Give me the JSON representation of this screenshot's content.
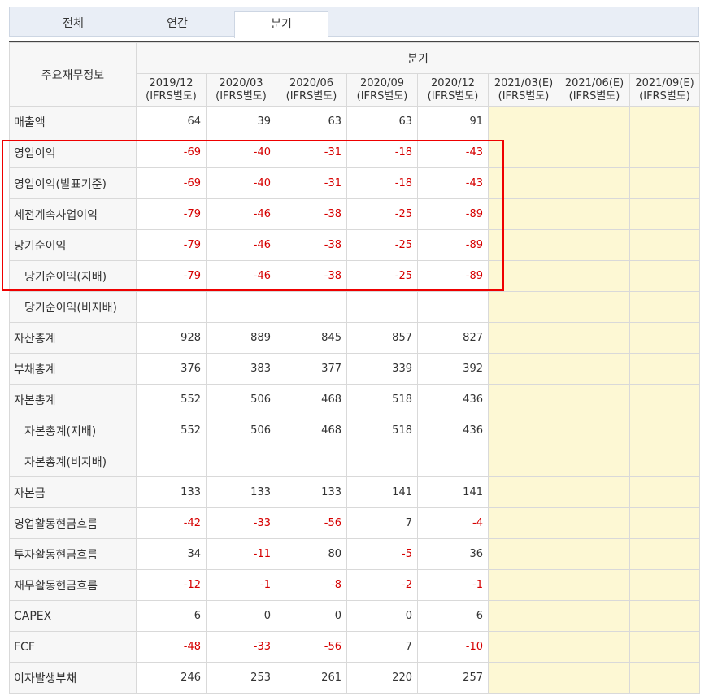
{
  "tabs": [
    {
      "label": "전체",
      "active": false
    },
    {
      "label": "연간",
      "active": false
    },
    {
      "label": "분기",
      "active": true
    }
  ],
  "table": {
    "corner_label": "주요재무정보",
    "group_label": "분기",
    "columns": [
      {
        "period": "2019/12",
        "basis": "(IFRS별도)"
      },
      {
        "period": "2020/03",
        "basis": "(IFRS별도)"
      },
      {
        "period": "2020/06",
        "basis": "(IFRS별도)"
      },
      {
        "period": "2020/09",
        "basis": "(IFRS별도)"
      },
      {
        "period": "2020/12",
        "basis": "(IFRS별도)"
      },
      {
        "period": "2021/03(E)",
        "basis": "(IFRS별도)"
      },
      {
        "period": "2021/06(E)",
        "basis": "(IFRS별도)"
      },
      {
        "period": "2021/09(E)",
        "basis": "(IFRS별도)"
      }
    ],
    "rows": [
      {
        "label": "매출액",
        "values": [
          "64",
          "39",
          "63",
          "63",
          "91",
          "",
          "",
          ""
        ]
      },
      {
        "label": "영업이익",
        "values": [
          "-69",
          "-40",
          "-31",
          "-18",
          "-43",
          "",
          "",
          ""
        ]
      },
      {
        "label": "영업이익(발표기준)",
        "values": [
          "-69",
          "-40",
          "-31",
          "-18",
          "-43",
          "",
          "",
          ""
        ]
      },
      {
        "label": "세전계속사업이익",
        "values": [
          "-79",
          "-46",
          "-38",
          "-25",
          "-89",
          "",
          "",
          ""
        ]
      },
      {
        "label": "당기순이익",
        "values": [
          "-79",
          "-46",
          "-38",
          "-25",
          "-89",
          "",
          "",
          ""
        ]
      },
      {
        "label": "당기순이익(지배)",
        "values": [
          "-79",
          "-46",
          "-38",
          "-25",
          "-89",
          "",
          "",
          ""
        ]
      },
      {
        "label": "당기순이익(비지배)",
        "values": [
          "",
          "",
          "",
          "",
          "",
          "",
          "",
          ""
        ]
      },
      {
        "label": "자산총계",
        "values": [
          "928",
          "889",
          "845",
          "857",
          "827",
          "",
          "",
          ""
        ]
      },
      {
        "label": "부채총계",
        "values": [
          "376",
          "383",
          "377",
          "339",
          "392",
          "",
          "",
          ""
        ]
      },
      {
        "label": "자본총계",
        "values": [
          "552",
          "506",
          "468",
          "518",
          "436",
          "",
          "",
          ""
        ]
      },
      {
        "label": "자본총계(지배)",
        "values": [
          "552",
          "506",
          "468",
          "518",
          "436",
          "",
          "",
          ""
        ]
      },
      {
        "label": "자본총계(비지배)",
        "values": [
          "",
          "",
          "",
          "",
          "",
          "",
          "",
          ""
        ]
      },
      {
        "label": "자본금",
        "values": [
          "133",
          "133",
          "133",
          "141",
          "141",
          "",
          "",
          ""
        ]
      },
      {
        "label": "영업활동현금흐름",
        "values": [
          "-42",
          "-33",
          "-56",
          "7",
          "-4",
          "",
          "",
          ""
        ]
      },
      {
        "label": "투자활동현금흐름",
        "values": [
          "34",
          "-11",
          "80",
          "-5",
          "36",
          "",
          "",
          ""
        ]
      },
      {
        "label": "재무활동현금흐름",
        "values": [
          "-12",
          "-1",
          "-8",
          "-2",
          "-1",
          "",
          "",
          ""
        ]
      },
      {
        "label": "CAPEX",
        "values": [
          "6",
          "0",
          "0",
          "0",
          "6",
          "",
          "",
          ""
        ]
      },
      {
        "label": "FCF",
        "values": [
          "-48",
          "-33",
          "-56",
          "7",
          "-10",
          "",
          "",
          ""
        ]
      },
      {
        "label": "이자발생부채",
        "values": [
          "246",
          "253",
          "261",
          "220",
          "257",
          "",
          "",
          ""
        ]
      }
    ]
  },
  "colors": {
    "negative": "#d60000",
    "estimate_bg": "#fdf8d4",
    "highlight_border": "#ef0000",
    "label_bg": "#f7f7f7"
  }
}
